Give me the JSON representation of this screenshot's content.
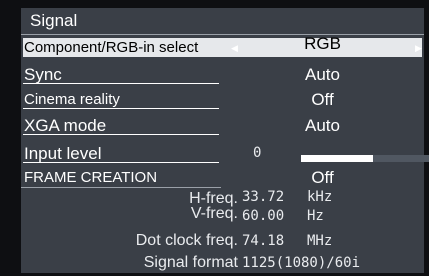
{
  "panel": {
    "title": "Signal"
  },
  "menu": [
    {
      "label": "Component/RGB-in select",
      "value": "RGB",
      "selected": true
    },
    {
      "label": "Sync",
      "value": "Auto"
    },
    {
      "label": "Cinema reality",
      "value": "Off"
    },
    {
      "label": "XGA mode",
      "value": "Auto"
    },
    {
      "label": "Input level",
      "value": "0",
      "level_fraction": 0.55
    },
    {
      "label": "FRAME CREATION",
      "value": "Off"
    }
  ],
  "info": [
    {
      "label": "H-freq.",
      "value": "33.72",
      "unit": "kHz"
    },
    {
      "label": "V-freq.",
      "value": "60.00",
      "unit": "Hz"
    },
    {
      "label": "Dot clock freq.",
      "value": "74.18",
      "unit": "MHz"
    },
    {
      "label": "Signal format",
      "value": "1125(1080)/60i",
      "unit": ""
    }
  ],
  "icons": {
    "left": "triangle-left-icon",
    "right": "triangle-right-icon"
  },
  "colors": {
    "panel": "#3a3f47",
    "selection": "#e6e8eb",
    "text": "#ffffff"
  }
}
